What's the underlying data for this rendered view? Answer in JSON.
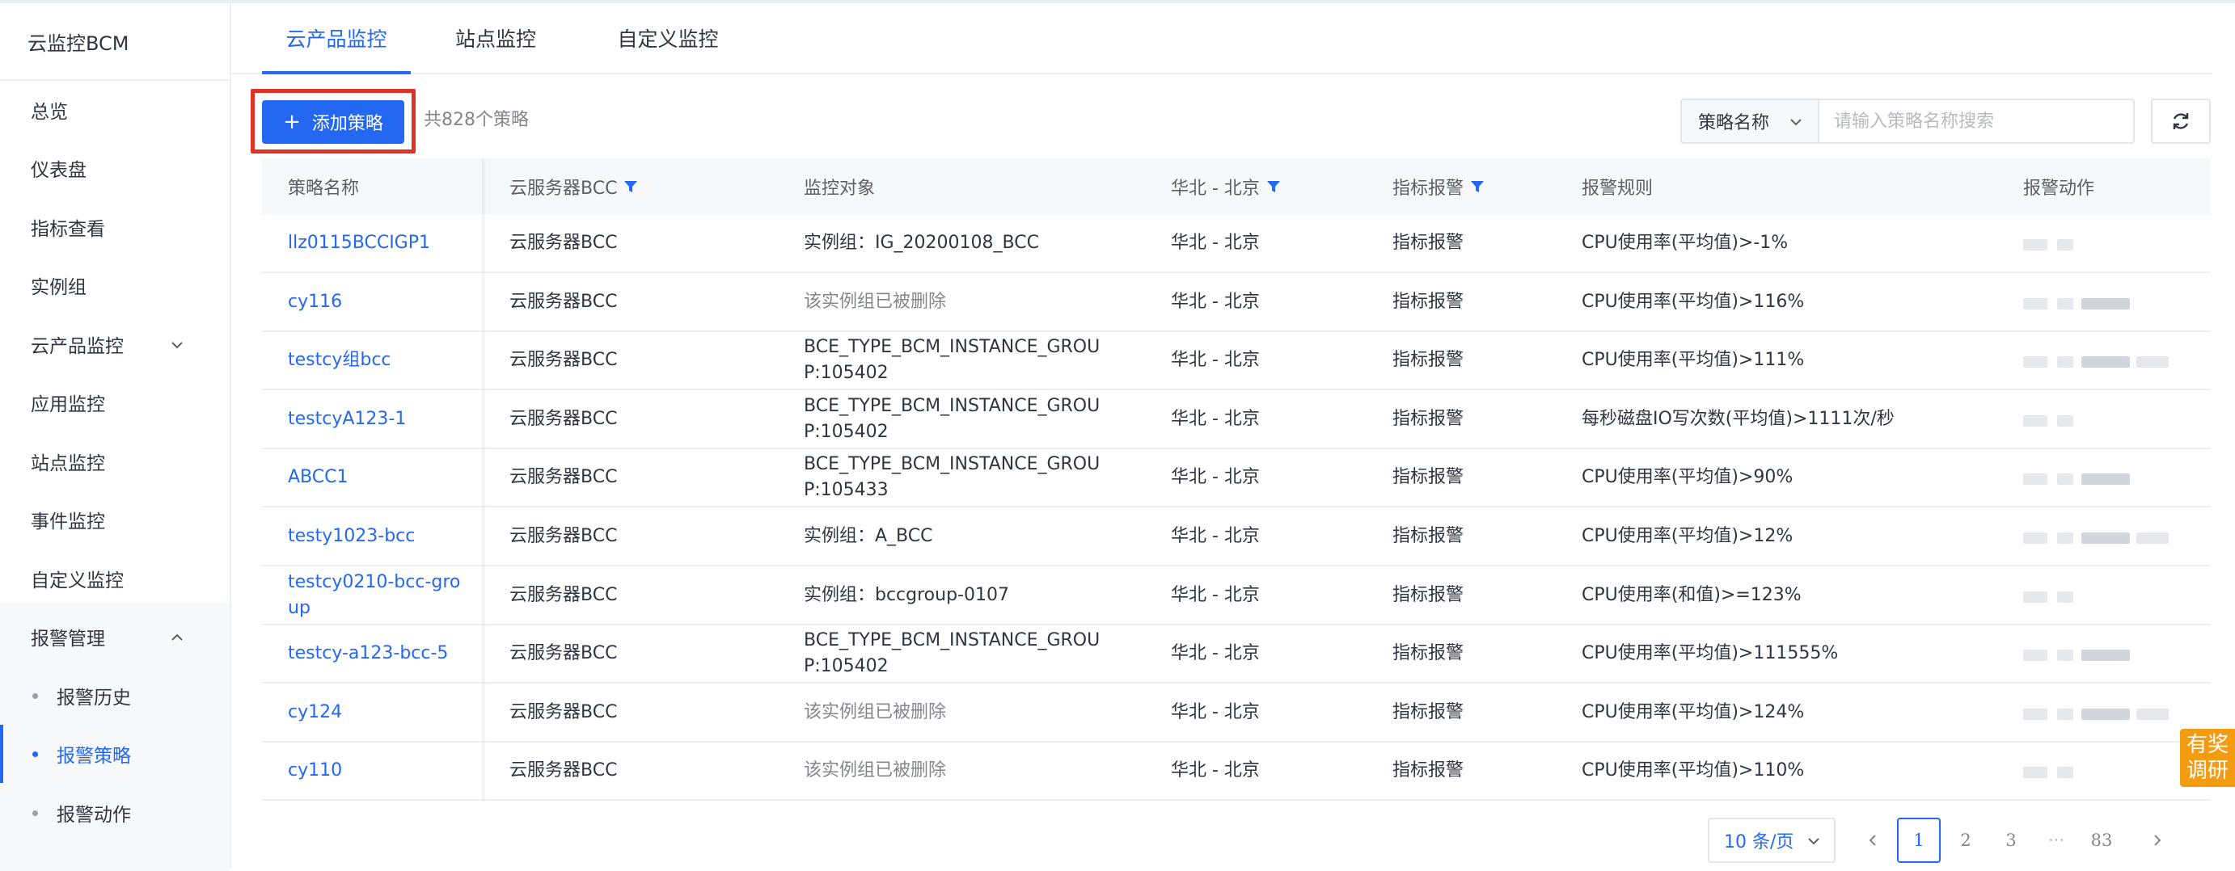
{
  "brand": "云监控BCM",
  "sidebar": {
    "items": [
      {
        "label": "总览"
      },
      {
        "label": "仪表盘"
      },
      {
        "label": "指标查看"
      },
      {
        "label": "实例组"
      },
      {
        "label": "云产品监控"
      },
      {
        "label": "应用监控"
      },
      {
        "label": "站点监控"
      },
      {
        "label": "事件监控"
      },
      {
        "label": "自定义监控"
      },
      {
        "label": "报警管理"
      }
    ],
    "sub_items": [
      {
        "label": "报警历史"
      },
      {
        "label": "报警策略"
      },
      {
        "label": "报警动作"
      }
    ]
  },
  "tabs": [
    {
      "label": "云产品监控"
    },
    {
      "label": "站点监控"
    },
    {
      "label": "自定义监控"
    }
  ],
  "toolbar": {
    "add_label": "添加策略",
    "count_text": "共828个策略",
    "filter_label": "策略名称",
    "search_placeholder": "请输入策略名称搜索"
  },
  "table": {
    "headers": [
      "策略名称",
      "云服务器BCC",
      "监控对象",
      "华北 - 北京",
      "指标报警",
      "报警规则",
      "报警动作"
    ],
    "rows": [
      {
        "name": "llz0115BCCIGP1",
        "service": "云服务器BCC",
        "target": "实例组：IG_20200108_BCC",
        "region": "华北 - 北京",
        "type": "指标报警",
        "rule": "CPU使用率(平均值)>-1%"
      },
      {
        "name": "cy116",
        "service": "云服务器BCC",
        "target": "该实例组已被删除",
        "region": "华北 - 北京",
        "type": "指标报警",
        "rule": "CPU使用率(平均值)>116%"
      },
      {
        "name": "testcy组bcc",
        "service": "云服务器BCC",
        "target": "BCE_TYPE_BCM_INSTANCE_GROUP:105402",
        "region": "华北 - 北京",
        "type": "指标报警",
        "rule": "CPU使用率(平均值)>111%"
      },
      {
        "name": "testcyA123-1",
        "service": "云服务器BCC",
        "target": "BCE_TYPE_BCM_INSTANCE_GROUP:105402",
        "region": "华北 - 北京",
        "type": "指标报警",
        "rule": "每秒磁盘IO写次数(平均值)>1111次/秒"
      },
      {
        "name": "ABCC1",
        "service": "云服务器BCC",
        "target": "BCE_TYPE_BCM_INSTANCE_GROUP:105433",
        "region": "华北 - 北京",
        "type": "指标报警",
        "rule": "CPU使用率(平均值)>90%"
      },
      {
        "name": "testy1023-bcc",
        "service": "云服务器BCC",
        "target": "实例组：A_BCC",
        "region": "华北 - 北京",
        "type": "指标报警",
        "rule": "CPU使用率(平均值)>12%"
      },
      {
        "name": "testcy0210-bcc-group",
        "service": "云服务器BCC",
        "target": "实例组：bccgroup-0107",
        "region": "华北 - 北京",
        "type": "指标报警",
        "rule": "CPU使用率(和值)>=123%"
      },
      {
        "name": "testcy-a123-bcc-5",
        "service": "云服务器BCC",
        "target": "BCE_TYPE_BCM_INSTANCE_GROUP:105402",
        "region": "华北 - 北京",
        "type": "指标报警",
        "rule": "CPU使用率(平均值)>111555%"
      },
      {
        "name": "cy124",
        "service": "云服务器BCC",
        "target": "该实例组已被删除",
        "region": "华北 - 北京",
        "type": "指标报警",
        "rule": "CPU使用率(平均值)>124%"
      },
      {
        "name": "cy110",
        "service": "云服务器BCC",
        "target": "该实例组已被删除",
        "region": "华北 - 北京",
        "type": "指标报警",
        "rule": "CPU使用率(平均值)>110%"
      }
    ]
  },
  "pagination": {
    "page_size": "10 条/页",
    "pages": [
      "1",
      "2",
      "3",
      "···",
      "83"
    ],
    "current": "1"
  },
  "promo": {
    "line1": "有奖",
    "line2": "调研"
  },
  "colors": {
    "primary": "#2468f2",
    "highlight": "#e03328",
    "promo": "#f39c12"
  }
}
